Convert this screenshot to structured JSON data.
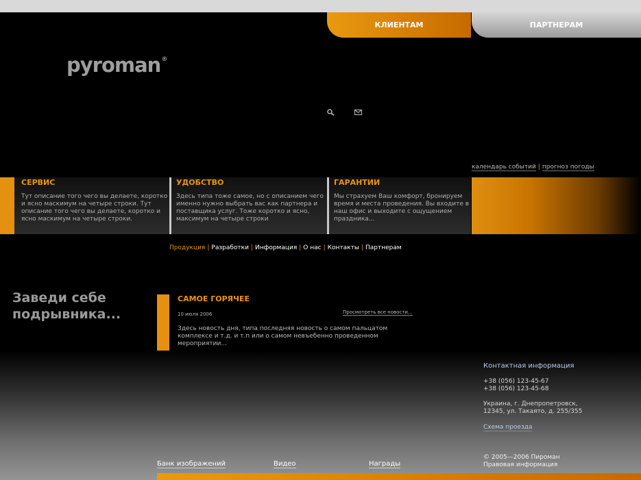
{
  "tabs": {
    "clients": "КЛИЕНТАМ",
    "partners": "ПАРТНЕРАМ"
  },
  "logo": {
    "text": "pyroman",
    "mark": "®"
  },
  "tools": {
    "search_icon": "search-icon",
    "mail_icon": "mail-icon"
  },
  "util_links": {
    "calendar": "календарь событий",
    "separator": "|",
    "weather": "прогноз погоды"
  },
  "features": [
    {
      "title": "СЕРВИС",
      "text": "Тут описание того чего вы делаете, коротко и ясно маскимум на четыре строки. Тут описание того чего вы делаете, коротко и ясно маскимум на четыре строки."
    },
    {
      "title": "УДОБСТВО",
      "text": "Здесь типа тоже самое, но с описанием чего именно нужно выбрать вас как партнера и поставщика услуг. Тоже коротко и ясно, максимум на четыре строки"
    },
    {
      "title": "ГАРАНТИИ",
      "text": "Мы страхуем Ваш комфорт, бронируем время и места проведения. Вы входите в наш офис и выходите с ощущением праздника..."
    }
  ],
  "nav": {
    "items": [
      "Продукция",
      "Разработки",
      "Информация",
      "О нас",
      "Контакты",
      "Партнерам"
    ],
    "separator": "|"
  },
  "slogan": "Заведи себе подрывника...",
  "hot": {
    "title": "САМОЕ ГОРЯЧЕЕ",
    "date": "10 июля 2006",
    "all_news": "Просмотреть все новости...",
    "text": "Здесь новость дня, типа последняя новость о самом пальцатом комплексе и т.д. и т.п или о самом невъебенно проведенном мероприятии..."
  },
  "contact": {
    "title": "Контактная информация",
    "phone1": "+38 (056) 123-45-67",
    "phone2": "+38 (056) 123-45-68",
    "address1": "Украина, г. Днепропетровск,",
    "address2": "12345, ул. Такаято, д. 255/355",
    "map_link": "Схема проезда"
  },
  "footer": {
    "links": [
      "Банк изображений",
      "Видео",
      "Награды"
    ],
    "copyright": "© 2005—2006 Пироман",
    "legal": "Правовая информация"
  },
  "colors": {
    "accent": "#e8950f",
    "link_blue": "#b9cbe8"
  }
}
